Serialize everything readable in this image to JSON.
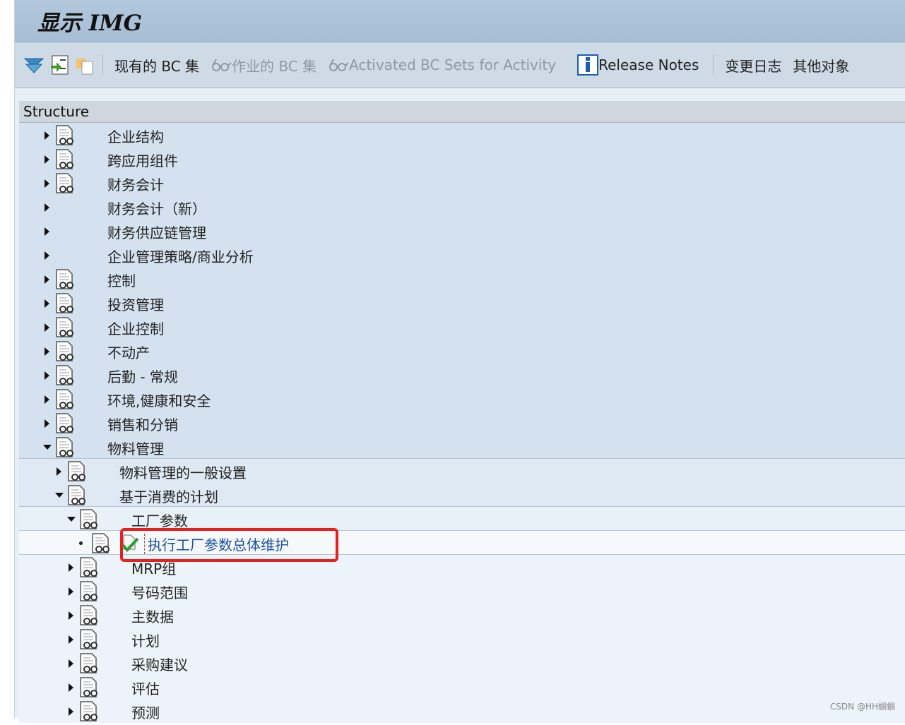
{
  "header": {
    "title": "显示 IMG"
  },
  "toolbar": {
    "items": [
      {
        "label": "现有的 BC 集",
        "disabled": false,
        "icon": "none"
      },
      {
        "label": "作业的 BC 集",
        "disabled": true,
        "icon": "glasses-icon"
      },
      {
        "label": "Activated BC Sets for Activity",
        "disabled": true,
        "icon": "glasses-icon"
      },
      {
        "label": "Release Notes",
        "disabled": false,
        "icon": "info-icon"
      },
      {
        "label": "变更日志",
        "disabled": false,
        "icon": "none"
      },
      {
        "label": "其他对象",
        "disabled": false,
        "icon": "none"
      }
    ]
  },
  "tree": {
    "header": "Structure",
    "rows": [
      {
        "label": "企业结构",
        "level": 0,
        "state": "collapsed",
        "doc": true
      },
      {
        "label": "跨应用组件",
        "level": 0,
        "state": "collapsed",
        "doc": true
      },
      {
        "label": "财务会计",
        "level": 0,
        "state": "collapsed",
        "doc": true
      },
      {
        "label": "财务会计（新）",
        "level": 0,
        "state": "collapsed",
        "doc": false
      },
      {
        "label": "财务供应链管理",
        "level": 0,
        "state": "collapsed",
        "doc": false
      },
      {
        "label": "企业管理策略/商业分析",
        "level": 0,
        "state": "collapsed",
        "doc": false
      },
      {
        "label": "控制",
        "level": 0,
        "state": "collapsed",
        "doc": true
      },
      {
        "label": "投资管理",
        "level": 0,
        "state": "collapsed",
        "doc": true
      },
      {
        "label": "企业控制",
        "level": 0,
        "state": "collapsed",
        "doc": true
      },
      {
        "label": "不动产",
        "level": 0,
        "state": "collapsed",
        "doc": true
      },
      {
        "label": "后勤 - 常规",
        "level": 0,
        "state": "collapsed",
        "doc": true
      },
      {
        "label": "环境,健康和安全",
        "level": 0,
        "state": "collapsed",
        "doc": true
      },
      {
        "label": "销售和分销",
        "level": 0,
        "state": "collapsed",
        "doc": true
      },
      {
        "label": "物料管理",
        "level": 0,
        "state": "expanded",
        "doc": true
      },
      {
        "label": "物料管理的一般设置",
        "level": 1,
        "state": "collapsed",
        "doc": true
      },
      {
        "label": "基于消费的计划",
        "level": 1,
        "state": "expanded",
        "doc": true
      },
      {
        "label": "工厂参数",
        "level": 2,
        "state": "expanded",
        "doc": true
      },
      {
        "label": "执行工厂参数总体维护",
        "level": 3,
        "state": "leaf",
        "doc": true,
        "executable": true,
        "highlighted": true
      },
      {
        "label": "MRP组",
        "level": 2,
        "state": "collapsed",
        "doc": true
      },
      {
        "label": "号码范围",
        "level": 2,
        "state": "collapsed",
        "doc": true
      },
      {
        "label": "主数据",
        "level": 2,
        "state": "collapsed",
        "doc": true
      },
      {
        "label": "计划",
        "level": 2,
        "state": "collapsed",
        "doc": true
      },
      {
        "label": "采购建议",
        "level": 2,
        "state": "collapsed",
        "doc": true
      },
      {
        "label": "评估",
        "level": 2,
        "state": "collapsed",
        "doc": true
      },
      {
        "label": "预测",
        "level": 2,
        "state": "collapsed",
        "doc": true
      }
    ]
  },
  "watermark": "CSDN @HH蝈蝈",
  "colors": {
    "highlight_box": "#e8201c",
    "link_text": "#1a4fa0"
  }
}
